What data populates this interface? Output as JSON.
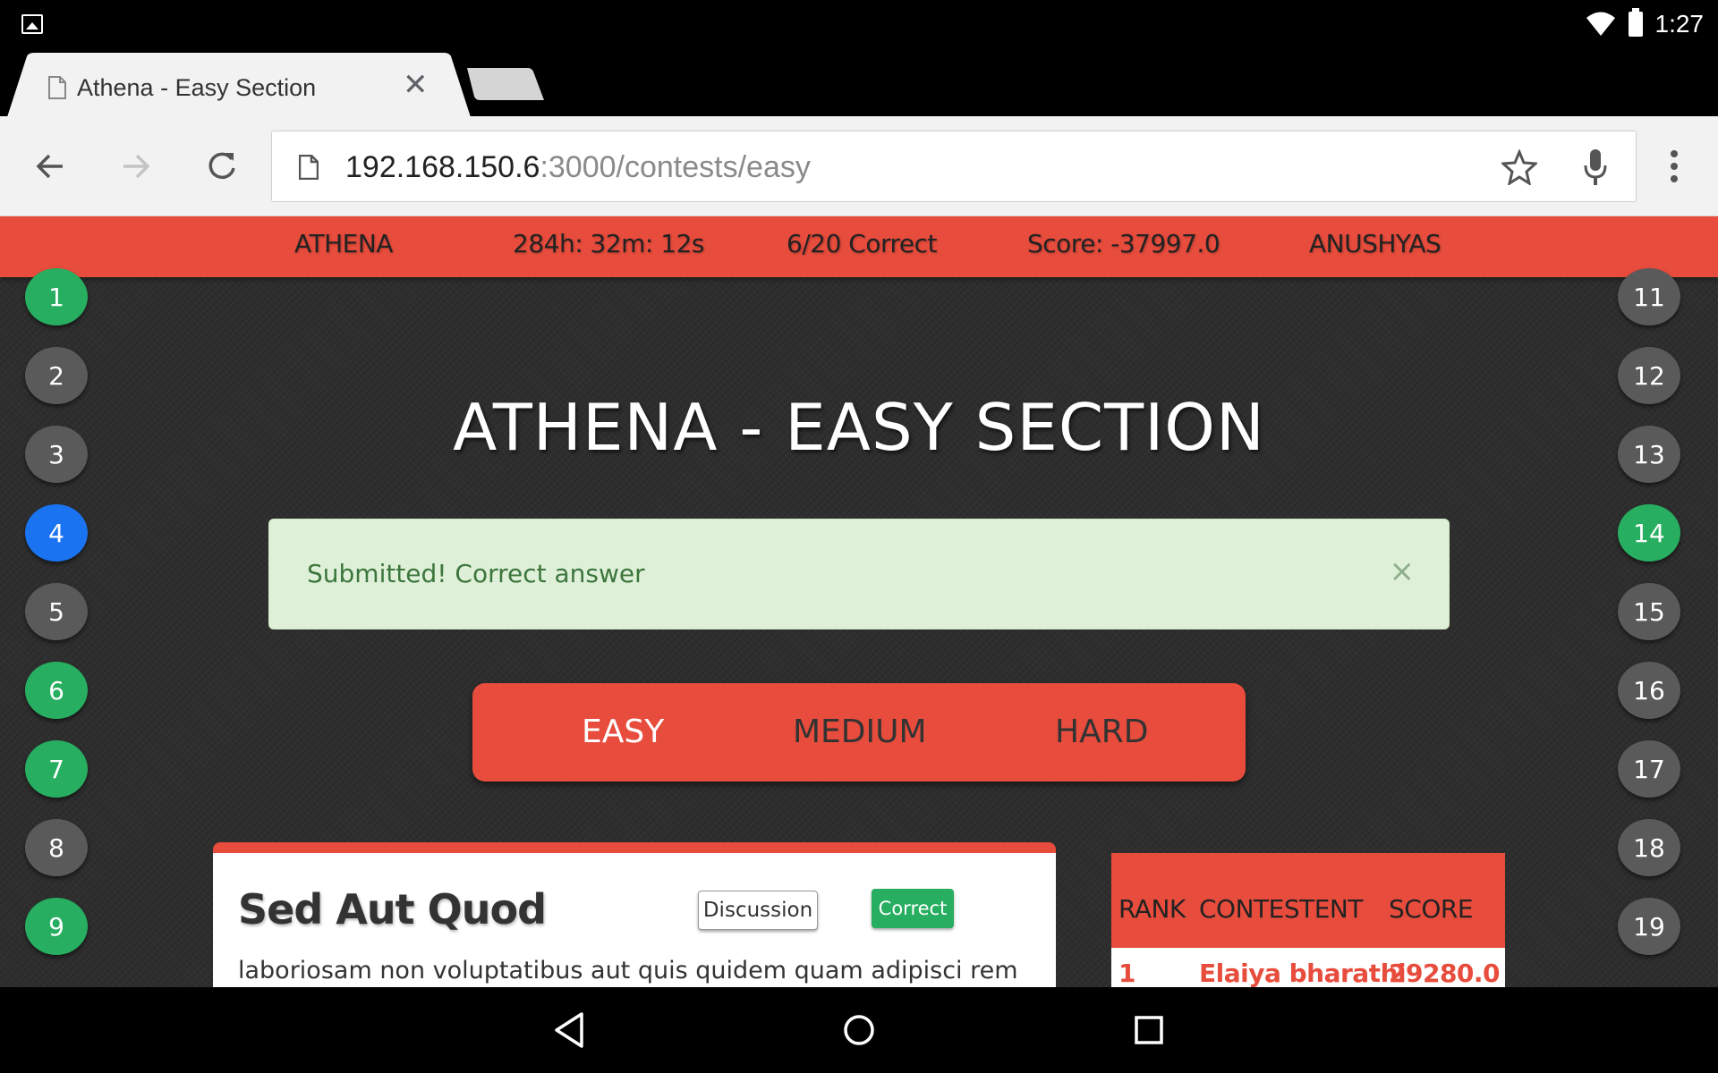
{
  "status_bar": {
    "time": "1:27"
  },
  "browser": {
    "tab": {
      "title": "Athena - Easy Section"
    },
    "url": {
      "host": "192.168.150.6",
      "path": ":3000/contests/easy"
    }
  },
  "header": {
    "brand": "ATHENA",
    "timer": "284h: 32m: 12s",
    "progress": "6/20 Correct",
    "score": "Score: -37997.0",
    "user": "ANUSHYAS"
  },
  "questions_left": [
    {
      "label": "1",
      "state": "correct"
    },
    {
      "label": "2",
      "state": "default"
    },
    {
      "label": "3",
      "state": "default"
    },
    {
      "label": "4",
      "state": "active"
    },
    {
      "label": "5",
      "state": "default"
    },
    {
      "label": "6",
      "state": "correct"
    },
    {
      "label": "7",
      "state": "correct"
    },
    {
      "label": "8",
      "state": "default"
    },
    {
      "label": "9",
      "state": "correct"
    }
  ],
  "questions_right": [
    {
      "label": "11",
      "state": "default"
    },
    {
      "label": "12",
      "state": "default"
    },
    {
      "label": "13",
      "state": "default"
    },
    {
      "label": "14",
      "state": "correct"
    },
    {
      "label": "15",
      "state": "default"
    },
    {
      "label": "16",
      "state": "default"
    },
    {
      "label": "17",
      "state": "default"
    },
    {
      "label": "18",
      "state": "default"
    },
    {
      "label": "19",
      "state": "default"
    }
  ],
  "colors": {
    "correct": "#27ae60",
    "default": "#5a5a5a",
    "active": "#1a73f0",
    "accent": "#e74c3c"
  },
  "page": {
    "heading": "ATHENA - EASY SECTION"
  },
  "alert": {
    "message": "Submitted! Correct answer",
    "close": "×"
  },
  "tabs": {
    "easy": "EASY",
    "medium": "MEDIUM",
    "hard": "HARD",
    "selected": "EASY"
  },
  "question": {
    "title": "Sed Aut Quod",
    "discussion_label": "Discussion",
    "status_label": "Correct",
    "text": "laboriosam non voluptatibus aut quis quidem quam adipisci rem"
  },
  "leaderboard": {
    "columns": [
      "RANK",
      "CONTESTENT",
      "SCORE"
    ],
    "rows": [
      {
        "rank": "1",
        "name": "Elaiya bharathi",
        "score": "29280.0"
      }
    ]
  }
}
